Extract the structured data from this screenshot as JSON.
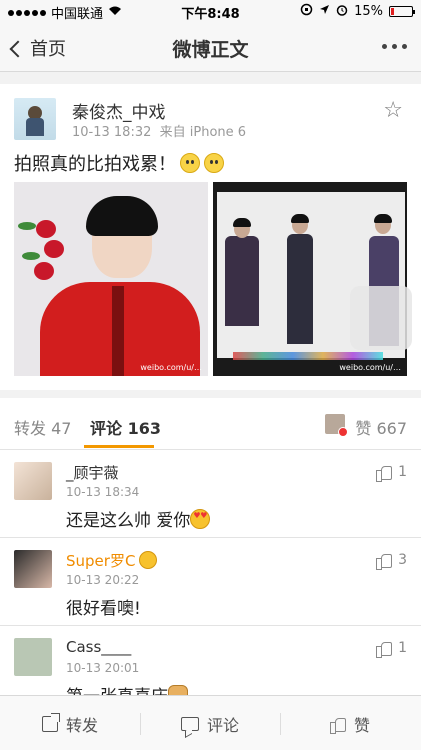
{
  "status_bar": {
    "carrier": "中国联通",
    "time": "下午8:48",
    "battery": "15%",
    "battery_level": 0.15,
    "icons": [
      "signal-dots-icon",
      "wifi-icon",
      "rotation-lock-icon",
      "location-arrow-icon",
      "alarm-icon",
      "battery-icon"
    ]
  },
  "nav": {
    "back_label": "首页",
    "title": "微博正文",
    "more_icon": "more-dots-icon"
  },
  "post": {
    "author": "秦俊杰_中戏",
    "time": "10-13 18:32",
    "source": "来自 iPhone 6",
    "text": "拍照真的比拍戏累！",
    "watermark_1": "weibo.com/u/…",
    "watermark_2": "weibo.com/u/…",
    "colors": {
      "accent": "#f39800",
      "verify_badge": "#f5a623",
      "jacket_red": "#d21e1e"
    }
  },
  "tabs": {
    "repost_label": "转发",
    "repost_count": "47",
    "comment_label": "评论",
    "comment_count": "163",
    "like_label": "赞",
    "like_count": "667"
  },
  "comments": [
    {
      "name": "_顾宇薇",
      "time": "10-13 18:34",
      "text": "还是这么帅 爱你",
      "likes": "1"
    },
    {
      "name": "Super罗C",
      "time": "10-13 20:22",
      "text": "很好看噢!",
      "likes": "3"
    },
    {
      "name": "Cass____",
      "time": "10-13 20:01",
      "text": "第一张真喜庆",
      "likes": "1"
    }
  ],
  "toolbar": {
    "repost": "转发",
    "comment": "评论",
    "like": "赞"
  }
}
